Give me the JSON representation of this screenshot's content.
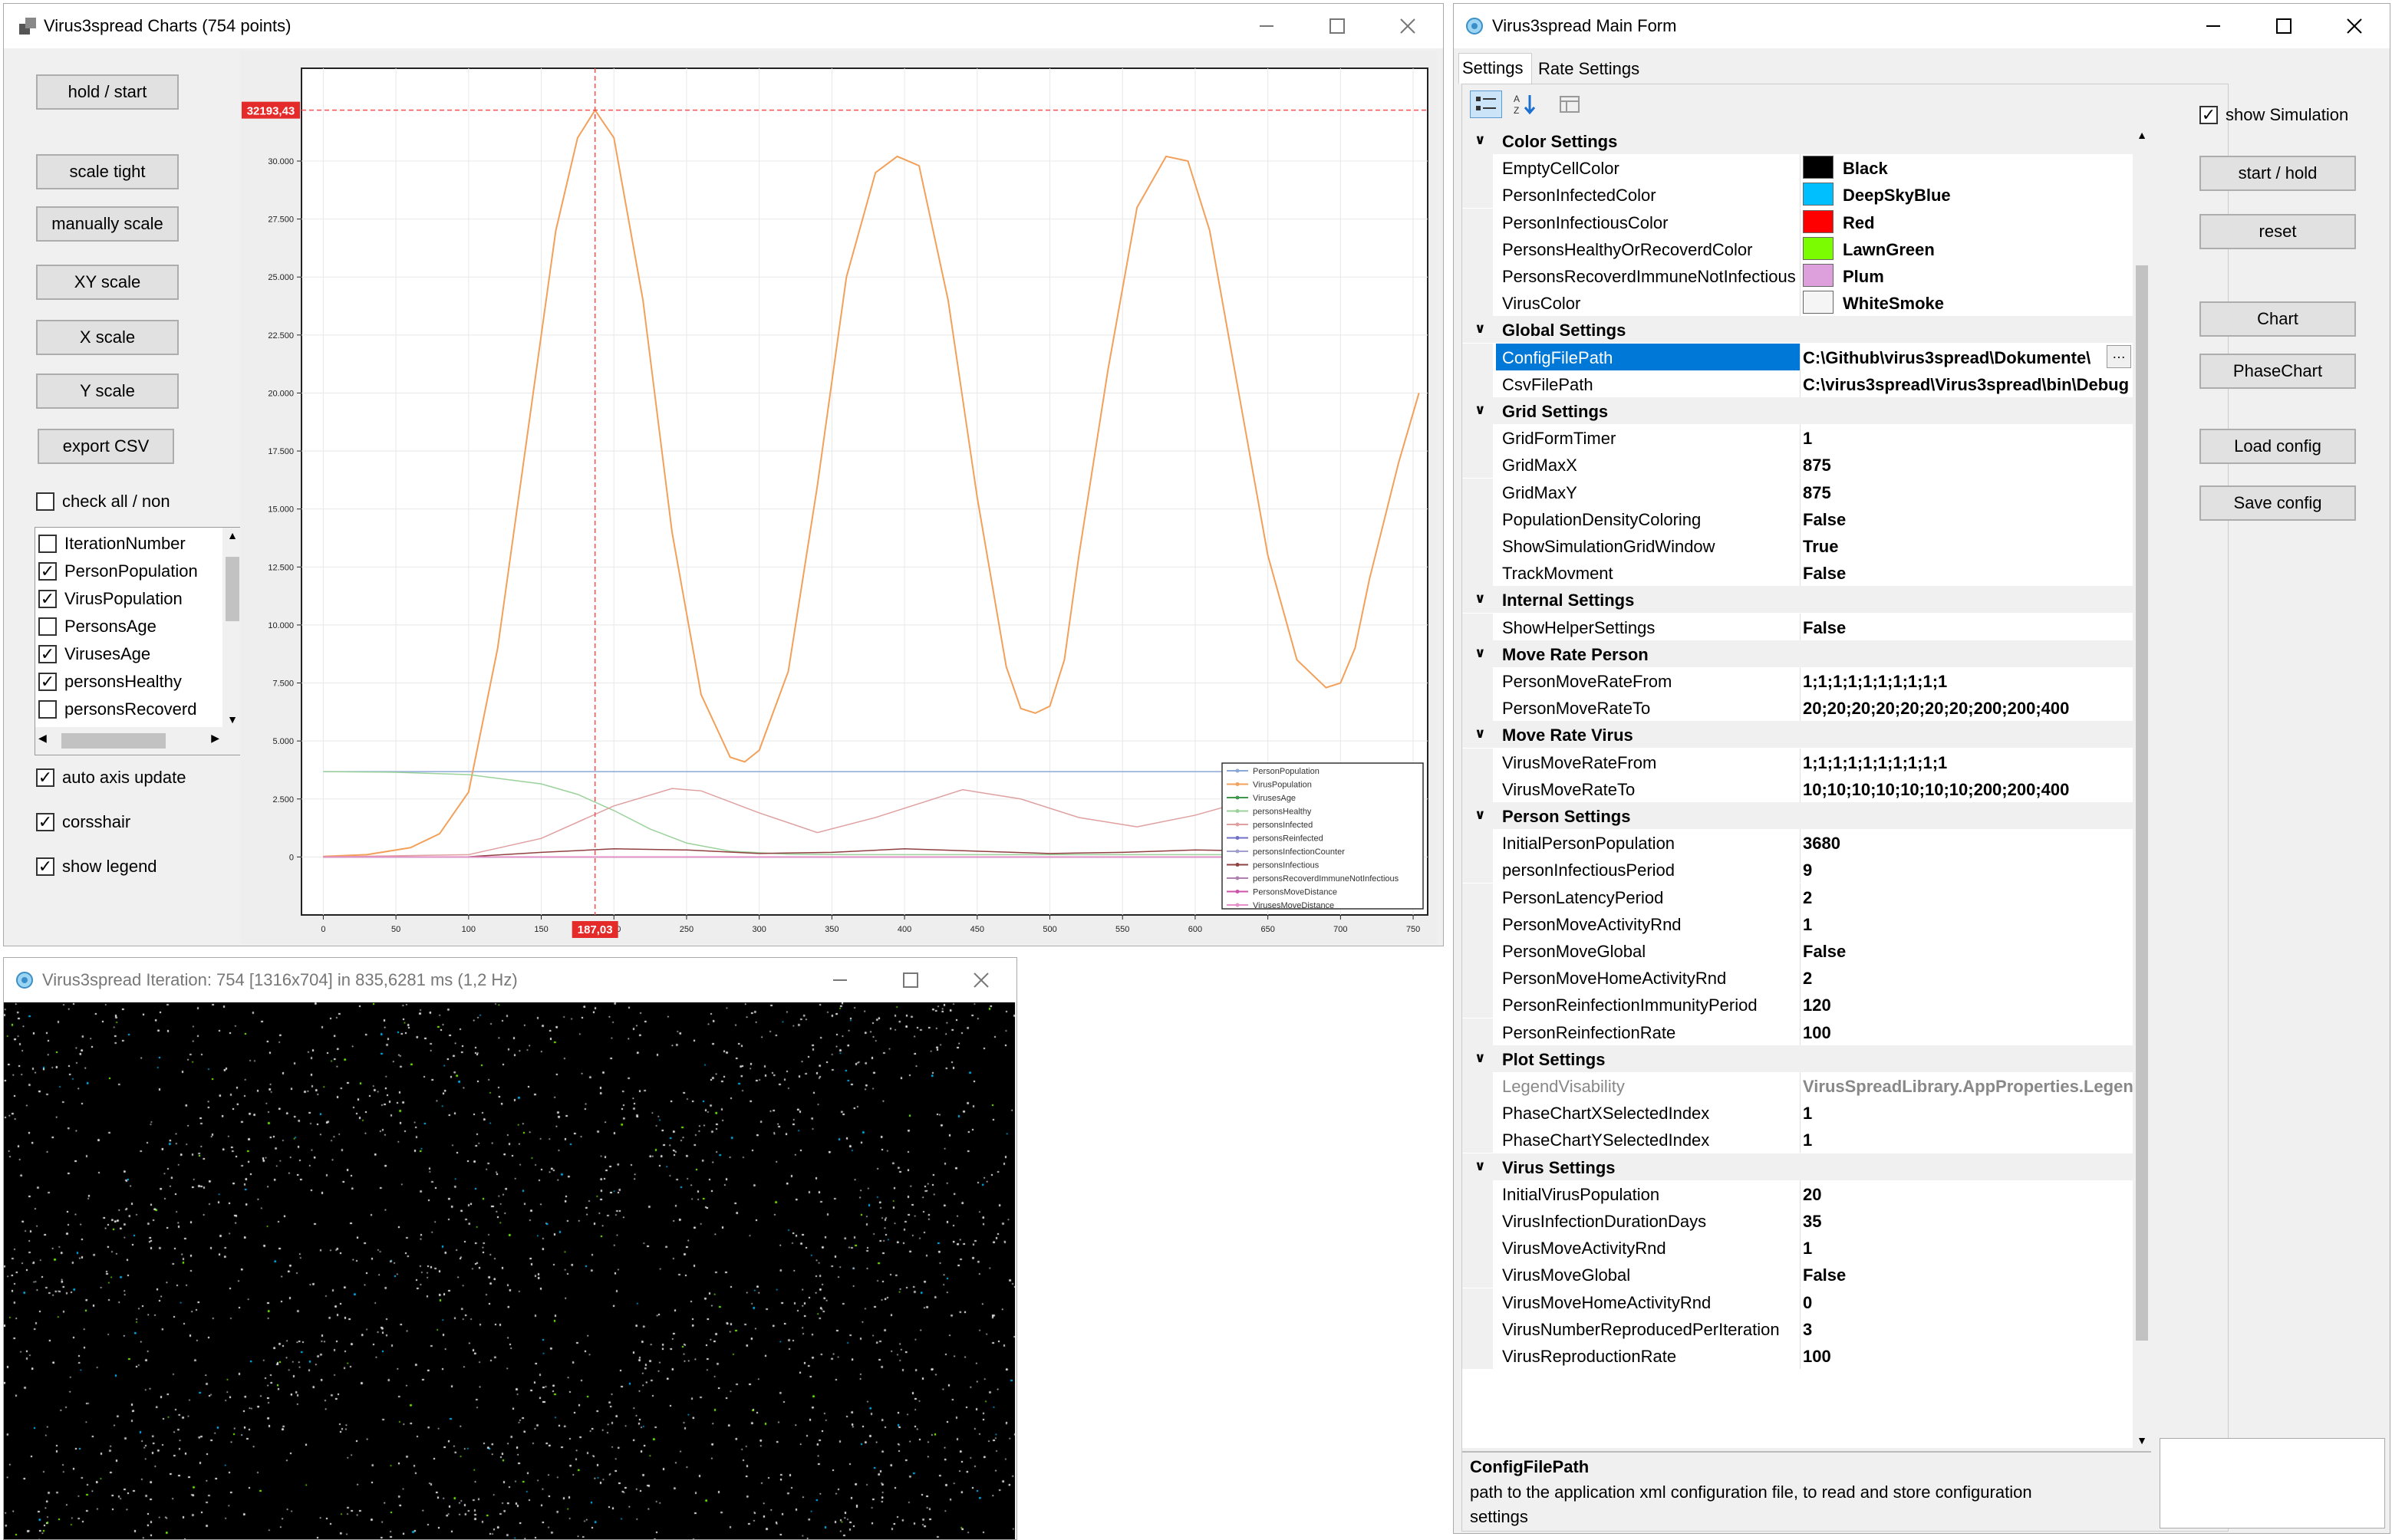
{
  "charts_window": {
    "title": "Virus3spread Charts (754 points)",
    "buttons": [
      "hold / start",
      "scale tight",
      "manually scale",
      "XY scale",
      "X scale",
      "Y scale",
      "export CSV"
    ],
    "check_all_label": "check all / non",
    "series_list": [
      {
        "label": "IterationNumber",
        "checked": false
      },
      {
        "label": "PersonPopulation",
        "checked": true
      },
      {
        "label": "VirusPopulation",
        "checked": true
      },
      {
        "label": "PersonsAge",
        "checked": false
      },
      {
        "label": "VirusesAge",
        "checked": true
      },
      {
        "label": "personsHealthy",
        "checked": true
      },
      {
        "label": "personsRecoverd",
        "checked": false
      }
    ],
    "auto_axis_update": "auto axis update",
    "crosshair": "corsshair",
    "show_legend": "show legend",
    "crosshair_y_label": "32193,43",
    "crosshair_x_label": "187,03"
  },
  "chart_data": {
    "type": "line",
    "title": "",
    "xlabel": "",
    "ylabel": "",
    "xlim": [
      -15,
      760
    ],
    "ylim": [
      -2500,
      34000
    ],
    "x_ticks": [
      0,
      50,
      100,
      150,
      200,
      250,
      300,
      350,
      400,
      450,
      500,
      550,
      600,
      650,
      700,
      750
    ],
    "y_ticks": [
      0,
      2500,
      5000,
      7500,
      10000,
      12500,
      15000,
      17500,
      20000,
      22500,
      25000,
      27500,
      30000
    ],
    "y_tick_labels": [
      "0",
      "2.500",
      "5.000",
      "7.500",
      "10.000",
      "12.500",
      "15.000",
      "17.500",
      "20.000",
      "22.500",
      "25.000",
      "27.500",
      "30.000"
    ],
    "grid": true,
    "legend_position": "bottom-right",
    "crosshair": {
      "x": 187.03,
      "y": 32193.43
    },
    "series": [
      {
        "name": "PersonPopulation",
        "color": "#8aa8d8",
        "x": [
          0,
          754
        ],
        "y": [
          3680,
          3680
        ]
      },
      {
        "name": "VirusPopulation",
        "color": "#f2a05a",
        "x": [
          0,
          30,
          60,
          80,
          100,
          120,
          140,
          160,
          175,
          187,
          200,
          220,
          240,
          260,
          280,
          290,
          300,
          320,
          340,
          360,
          380,
          395,
          410,
          430,
          450,
          470,
          480,
          490,
          500,
          510,
          520,
          540,
          560,
          580,
          595,
          610,
          630,
          650,
          670,
          690,
          700,
          710,
          720,
          740,
          754
        ],
        "y": [
          20,
          100,
          400,
          1000,
          2800,
          9000,
          18000,
          27000,
          31000,
          32193,
          31000,
          24000,
          14000,
          7000,
          4300,
          4100,
          4600,
          8000,
          16000,
          25000,
          29500,
          30200,
          29800,
          24000,
          15500,
          8200,
          6400,
          6200,
          6500,
          8500,
          13000,
          21000,
          28000,
          30200,
          30000,
          27000,
          20000,
          13000,
          8500,
          7300,
          7500,
          9000,
          12000,
          17000,
          20000
        ]
      },
      {
        "name": "VirusesAge",
        "color": "#3c9a4a",
        "x": [
          0,
          754
        ],
        "y": [
          0,
          0
        ]
      },
      {
        "name": "personsHealthy",
        "color": "#9bd29b",
        "x": [
          0,
          50,
          100,
          150,
          175,
          200,
          225,
          250,
          280,
          320,
          360,
          400,
          500,
          600,
          700,
          754
        ],
        "y": [
          3680,
          3650,
          3550,
          3150,
          2700,
          2000,
          1200,
          600,
          250,
          120,
          100,
          100,
          100,
          100,
          100,
          100
        ]
      },
      {
        "name": "personsInfected",
        "color": "#e0a0a0",
        "x": [
          0,
          100,
          150,
          200,
          240,
          260,
          300,
          340,
          380,
          440,
          480,
          520,
          560,
          600,
          640,
          680,
          720,
          754
        ],
        "y": [
          0,
          100,
          800,
          2200,
          2950,
          2850,
          1900,
          1050,
          1700,
          2900,
          2500,
          1700,
          1300,
          1800,
          2500,
          2700,
          2900,
          3000
        ]
      },
      {
        "name": "personsReinfected",
        "color": "#7070c8",
        "x": [
          0,
          754
        ],
        "y": [
          0,
          0
        ]
      },
      {
        "name": "personsInfectionCounter",
        "color": "#a0a0d0",
        "x": [
          0,
          754
        ],
        "y": [
          0,
          0
        ]
      },
      {
        "name": "personsInfectious",
        "color": "#904040",
        "x": [
          0,
          100,
          150,
          200,
          250,
          300,
          350,
          400,
          450,
          500,
          550,
          600,
          650,
          700,
          754
        ],
        "y": [
          0,
          10,
          200,
          350,
          300,
          150,
          200,
          350,
          250,
          150,
          200,
          300,
          250,
          200,
          250
        ]
      },
      {
        "name": "personsRecoverdImmuneNotInfectious",
        "color": "#b080b0",
        "x": [
          0,
          754
        ],
        "y": [
          0,
          0
        ]
      },
      {
        "name": "PersonsMoveDistance",
        "color": "#cc55aa",
        "x": [
          0,
          754
        ],
        "y": [
          0,
          0
        ]
      },
      {
        "name": "VirusesMoveDistance",
        "color": "#e890c8",
        "x": [
          0,
          754
        ],
        "y": [
          0,
          0
        ]
      }
    ]
  },
  "iteration_window": {
    "title": "Virus3spread Iteration: 754 [1316x704] in 835,6281 ms (1,2 Hz)"
  },
  "main_form": {
    "title": "Virus3spread Main Form",
    "tabs": [
      "Settings",
      "Rate Settings"
    ],
    "groups": [
      {
        "name": "Color Settings",
        "props": [
          {
            "name": "EmptyCellColor",
            "value": "Black",
            "color": "#000000"
          },
          {
            "name": "PersonInfectedColor",
            "value": "DeepSkyBlue",
            "color": "#00bfff"
          },
          {
            "name": "PersonInfectiousColor",
            "value": "Red",
            "color": "#ff0000"
          },
          {
            "name": "PersonsHealthyOrRecoverdColor",
            "value": "LawnGreen",
            "color": "#7cfc00"
          },
          {
            "name": "PersonsRecoverdImmuneNotInfectious",
            "value": "Plum",
            "color": "#dda0dd"
          },
          {
            "name": "VirusColor",
            "value": "WhiteSmoke",
            "color": "#f5f5f5"
          }
        ]
      },
      {
        "name": "Global Settings",
        "props": [
          {
            "name": "ConfigFilePath",
            "value": "C:\\Github\\virus3spread\\Dokumente\\",
            "selected": true
          },
          {
            "name": "CsvFilePath",
            "value": "C:\\virus3spread\\Virus3spread\\bin\\Debug"
          }
        ]
      },
      {
        "name": "Grid Settings",
        "props": [
          {
            "name": "GridFormTimer",
            "value": "1"
          },
          {
            "name": "GridMaxX",
            "value": "875"
          },
          {
            "name": "GridMaxY",
            "value": "875"
          },
          {
            "name": "PopulationDensityColoring",
            "value": "False"
          },
          {
            "name": "ShowSimulationGridWindow",
            "value": "True"
          },
          {
            "name": "TrackMovment",
            "value": "False"
          }
        ]
      },
      {
        "name": "Internal Settings",
        "props": [
          {
            "name": "ShowHelperSettings",
            "value": "False"
          }
        ]
      },
      {
        "name": "Move Rate Person",
        "props": [
          {
            "name": "PersonMoveRateFrom",
            "value": "1;1;1;1;1;1;1;1;1;1"
          },
          {
            "name": "PersonMoveRateTo",
            "value": "20;20;20;20;20;20;20;200;200;400"
          }
        ]
      },
      {
        "name": "Move Rate Virus",
        "props": [
          {
            "name": "VirusMoveRateFrom",
            "value": "1;1;1;1;1;1;1;1;1;1"
          },
          {
            "name": "VirusMoveRateTo",
            "value": "10;10;10;10;10;10;10;200;200;400"
          }
        ]
      },
      {
        "name": "Person Settings",
        "props": [
          {
            "name": "InitialPersonPopulation",
            "value": "3680"
          },
          {
            "name": "personInfectiousPeriod",
            "value": "9"
          },
          {
            "name": "PersonLatencyPeriod",
            "value": "2"
          },
          {
            "name": "PersonMoveActivityRnd",
            "value": "1"
          },
          {
            "name": "PersonMoveGlobal",
            "value": "False"
          },
          {
            "name": "PersonMoveHomeActivityRnd",
            "value": "2"
          },
          {
            "name": "PersonReinfectionImmunityPeriod",
            "value": "120"
          },
          {
            "name": "PersonReinfectionRate",
            "value": "100"
          }
        ]
      },
      {
        "name": "Plot Settings",
        "props": [
          {
            "name": "LegendVisability",
            "value": "VirusSpreadLibrary.AppProperties.Legend",
            "grey": true
          },
          {
            "name": "PhaseChartXSelectedIndex",
            "value": "1"
          },
          {
            "name": "PhaseChartYSelectedIndex",
            "value": "1"
          }
        ]
      },
      {
        "name": "Virus Settings",
        "props": [
          {
            "name": "InitialVirusPopulation",
            "value": "20"
          },
          {
            "name": "VirusInfectionDurationDays",
            "value": "35"
          },
          {
            "name": "VirusMoveActivityRnd",
            "value": "1"
          },
          {
            "name": "VirusMoveGlobal",
            "value": "False"
          },
          {
            "name": "VirusMoveHomeActivityRnd",
            "value": "0"
          },
          {
            "name": "VirusNumberReproducedPerIteration",
            "value": "3"
          },
          {
            "name": "VirusReproductionRate",
            "value": "100"
          }
        ]
      }
    ],
    "description_title": "ConfigFilePath",
    "description_text": "path to the application xml configuration file, to read and store configuration settings",
    "show_simulation": "show Simulation",
    "buttons": [
      "start / hold",
      "reset",
      "Chart",
      "PhaseChart",
      "Load config",
      "Save config"
    ]
  }
}
